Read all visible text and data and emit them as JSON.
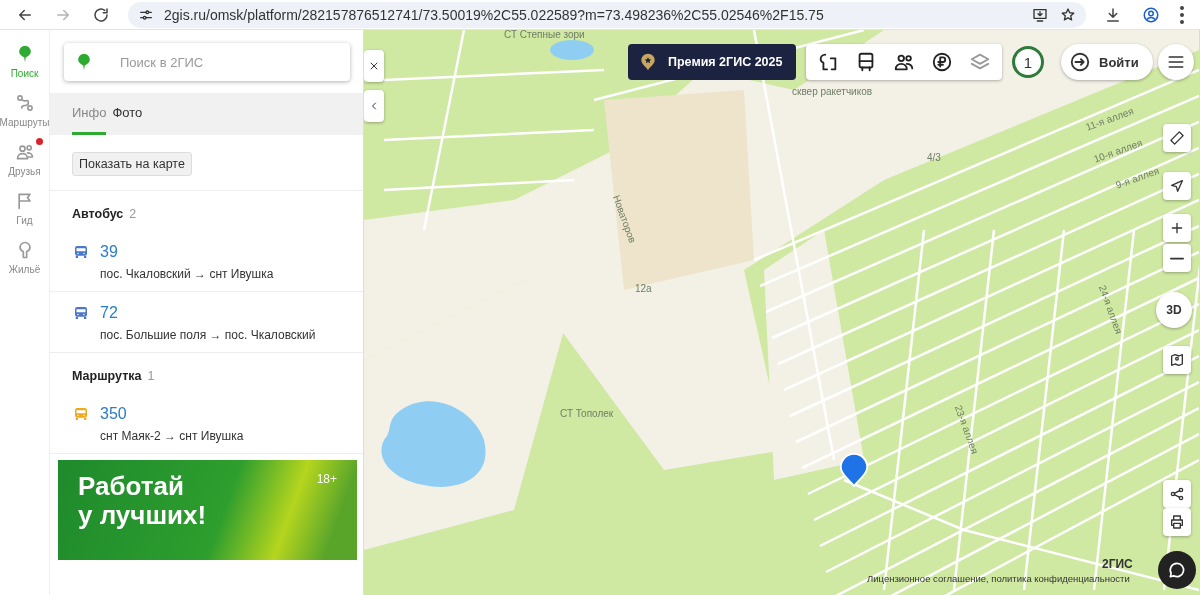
{
  "browser": {
    "url": "2gis.ru/omsk/platform/282157876512741/73.50019%2C55.022589?m=73.498236%2C55.02546%2F15.75"
  },
  "rail": [
    {
      "label": "Поиск",
      "selected": true,
      "notification": false
    },
    {
      "label": "Маршруты",
      "selected": false,
      "notification": false
    },
    {
      "label": "Друзья",
      "selected": false,
      "notification": true
    },
    {
      "label": "Гид",
      "selected": false,
      "notification": false
    },
    {
      "label": "Жильё",
      "selected": false,
      "notification": false
    }
  ],
  "search": {
    "placeholder": "Поиск в 2ГИС"
  },
  "tabs": [
    {
      "label": "Инфо",
      "selected": true
    },
    {
      "label": "Фото",
      "selected": false
    }
  ],
  "show_on_map_button": "Показать на карте",
  "sections": [
    {
      "title": "Автобус",
      "count": "2",
      "routes": [
        {
          "kind": "bus",
          "number": "39",
          "direction": "пос. Чкаловский → снт Ивушка"
        },
        {
          "kind": "bus",
          "number": "72",
          "direction": "пос. Большие поля → пос. Чкаловский"
        }
      ]
    },
    {
      "title": "Маршрутка",
      "count": "1",
      "routes": [
        {
          "kind": "minibus",
          "number": "350",
          "direction": "снт Маяк-2 → снт Ивушка"
        }
      ]
    }
  ],
  "ad": {
    "headline": [
      "Работай",
      "у лучших!"
    ],
    "age": "18+"
  },
  "map": {
    "award": "Премия 2ГИС 2025",
    "counter": "1",
    "login": "Войти",
    "mode_3d": "3D",
    "logo": "2ГИС",
    "footer": "Лицензионное соглашение, политика конфиденциальности",
    "labels": [
      "СТ Степные зори",
      "сквер ракетчиков",
      "Новаторов",
      "12а",
      "СТ Тополек",
      "11-я аллея",
      "10-я аллея",
      "9-я аллея",
      "24-я аллея",
      "23-я аллея",
      "4/3"
    ]
  }
}
